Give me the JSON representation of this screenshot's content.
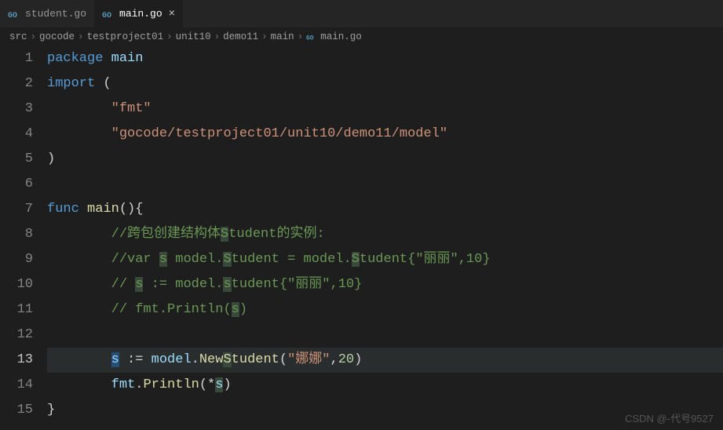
{
  "tabs": [
    {
      "label": "student.go",
      "active": false
    },
    {
      "label": "main.go",
      "active": true
    }
  ],
  "breadcrumb": {
    "items": [
      "src",
      "gocode",
      "testproject01",
      "unit10",
      "demo11",
      "main",
      "main.go"
    ]
  },
  "code": {
    "lines": [
      {
        "n": 1,
        "t": [
          [
            "kw",
            "package"
          ],
          [
            "sp",
            " "
          ],
          [
            "ident",
            "main"
          ]
        ]
      },
      {
        "n": 2,
        "t": [
          [
            "kw",
            "import"
          ],
          [
            "sp",
            " "
          ],
          [
            "punc",
            "("
          ]
        ]
      },
      {
        "n": 3,
        "t": [
          [
            "sp",
            "        "
          ],
          [
            "str",
            "\"fmt\""
          ]
        ]
      },
      {
        "n": 4,
        "t": [
          [
            "sp",
            "        "
          ],
          [
            "str",
            "\"gocode/testproject01/unit10/demo11/model\""
          ]
        ]
      },
      {
        "n": 5,
        "t": [
          [
            "punc",
            ")"
          ]
        ]
      },
      {
        "n": 6,
        "t": []
      },
      {
        "n": 7,
        "t": [
          [
            "kw",
            "func"
          ],
          [
            "sp",
            " "
          ],
          [
            "fn",
            "main"
          ],
          [
            "punc",
            "(){"
          ]
        ]
      },
      {
        "n": 8,
        "t": [
          [
            "sp",
            "        "
          ],
          [
            "cmt",
            "//跨包创建结构体"
          ],
          [
            "cmt hl",
            "S"
          ],
          [
            "cmt",
            "tudent的实例:"
          ]
        ]
      },
      {
        "n": 9,
        "t": [
          [
            "sp",
            "        "
          ],
          [
            "cmt",
            "//var "
          ],
          [
            "cmt hl",
            "s"
          ],
          [
            "cmt",
            " model."
          ],
          [
            "cmt hl",
            "S"
          ],
          [
            "cmt",
            "tudent = model."
          ],
          [
            "cmt hl",
            "S"
          ],
          [
            "cmt",
            "tudent{\"丽丽\",10}"
          ]
        ]
      },
      {
        "n": 10,
        "t": [
          [
            "sp",
            "        "
          ],
          [
            "cmt",
            "// "
          ],
          [
            "cmt hl",
            "s"
          ],
          [
            "cmt",
            " := model."
          ],
          [
            "cmt hl",
            "s"
          ],
          [
            "cmt",
            "tudent{\"丽丽\",10}"
          ]
        ]
      },
      {
        "n": 11,
        "t": [
          [
            "sp",
            "        "
          ],
          [
            "cmt",
            "// fmt.Println("
          ],
          [
            "cmt hl",
            "s"
          ],
          [
            "cmt",
            ")"
          ]
        ]
      },
      {
        "n": 12,
        "t": []
      },
      {
        "n": 13,
        "active": true,
        "t": [
          [
            "sp",
            "        "
          ],
          [
            "ident hlw",
            "s"
          ],
          [
            "sp",
            " "
          ],
          [
            "punc",
            ":= "
          ],
          [
            "ident",
            "model"
          ],
          [
            "punc",
            "."
          ],
          [
            "fn",
            "New"
          ],
          [
            "fn hl",
            "S"
          ],
          [
            "fn",
            "tudent"
          ],
          [
            "punc",
            "("
          ],
          [
            "str",
            "\"娜娜\""
          ],
          [
            "punc",
            ","
          ],
          [
            "num",
            "20"
          ],
          [
            "punc",
            ")"
          ]
        ]
      },
      {
        "n": 14,
        "t": [
          [
            "sp",
            "        "
          ],
          [
            "ident",
            "fmt"
          ],
          [
            "punc",
            "."
          ],
          [
            "fn",
            "Println"
          ],
          [
            "punc",
            "(*"
          ],
          [
            "ident hl",
            "s"
          ],
          [
            "punc",
            ")"
          ]
        ]
      },
      {
        "n": 15,
        "t": [
          [
            "punc",
            "}"
          ]
        ]
      }
    ]
  },
  "watermark": "CSDN @-代号9527"
}
